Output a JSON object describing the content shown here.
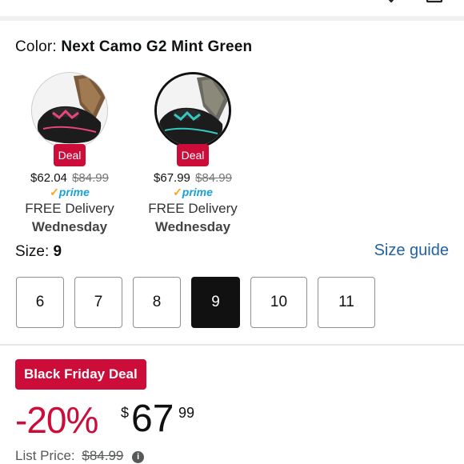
{
  "color": {
    "label": "Color:",
    "value": "Next Camo G2 Mint Green"
  },
  "swatches": [
    {
      "badge": "Deal",
      "price": "$62.04",
      "old_price": "$84.99",
      "prime": "prime",
      "delivery": "FREE Delivery",
      "day": "Wednesday",
      "accent": "#e8457a",
      "selected": false
    },
    {
      "badge": "Deal",
      "price": "$67.99",
      "old_price": "$84.99",
      "prime": "prime",
      "delivery": "FREE Delivery",
      "day": "Wednesday",
      "accent": "#36c7c0",
      "selected": true
    }
  ],
  "size": {
    "label": "Size:",
    "value": "9",
    "guide": "Size guide",
    "options": [
      "6",
      "7",
      "8",
      "9",
      "10",
      "11"
    ],
    "selected": "9"
  },
  "deal": {
    "badge": "Black Friday Deal",
    "discount": "-20%",
    "currency": "$",
    "whole": "67",
    "fraction": "99",
    "list_label": "List Price:",
    "list_price": "$84.99"
  },
  "colors": {
    "deal_red": "#cc0c39",
    "link_blue": "#2162a1",
    "prime_blue": "#1ba0d8"
  },
  "icons": [
    "heart-icon",
    "bag-icon",
    "info-icon"
  ]
}
